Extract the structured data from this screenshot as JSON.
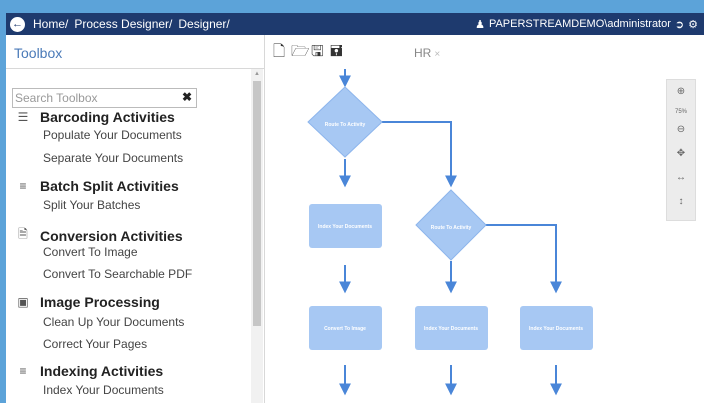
{
  "header": {
    "breadcrumbs": [
      "Home/",
      "Process Designer/",
      "Designer/"
    ],
    "user": "PAPERSTREAMDEMO\\administrator"
  },
  "toolbox": {
    "title": "Toolbox",
    "search_placeholder": "Search Toolbox",
    "categories": [
      {
        "label": "Barcoding Activities",
        "icon": "barcode-icon",
        "items": [
          "Populate Your Documents",
          "Separate Your Documents"
        ]
      },
      {
        "label": "Batch Split Activities",
        "icon": "menu-lines-icon",
        "items": [
          "Split Your Batches"
        ]
      },
      {
        "label": "Conversion Activities",
        "icon": "document-icon",
        "items": [
          "Convert To Image",
          "Convert To Searchable PDF"
        ]
      },
      {
        "label": "Image Processing",
        "icon": "image-icon",
        "items": [
          "Clean Up Your Documents",
          "Correct Your Pages"
        ]
      },
      {
        "label": "Indexing Activities",
        "icon": "menu-lines-icon",
        "items": [
          "Index Your Documents"
        ]
      }
    ]
  },
  "canvas": {
    "tab_label": "HR",
    "tab_close": "×",
    "zoom": "75%",
    "nodes": {
      "route1": "Route To Activity",
      "index1": "Index Your Documents",
      "route2": "Route To Activity",
      "convert": "Convert To Image",
      "index2": "Index Your Documents",
      "index3": "Index Your Documents"
    },
    "node_color": "#a7c8f3",
    "line_color": "#4a86d8"
  }
}
